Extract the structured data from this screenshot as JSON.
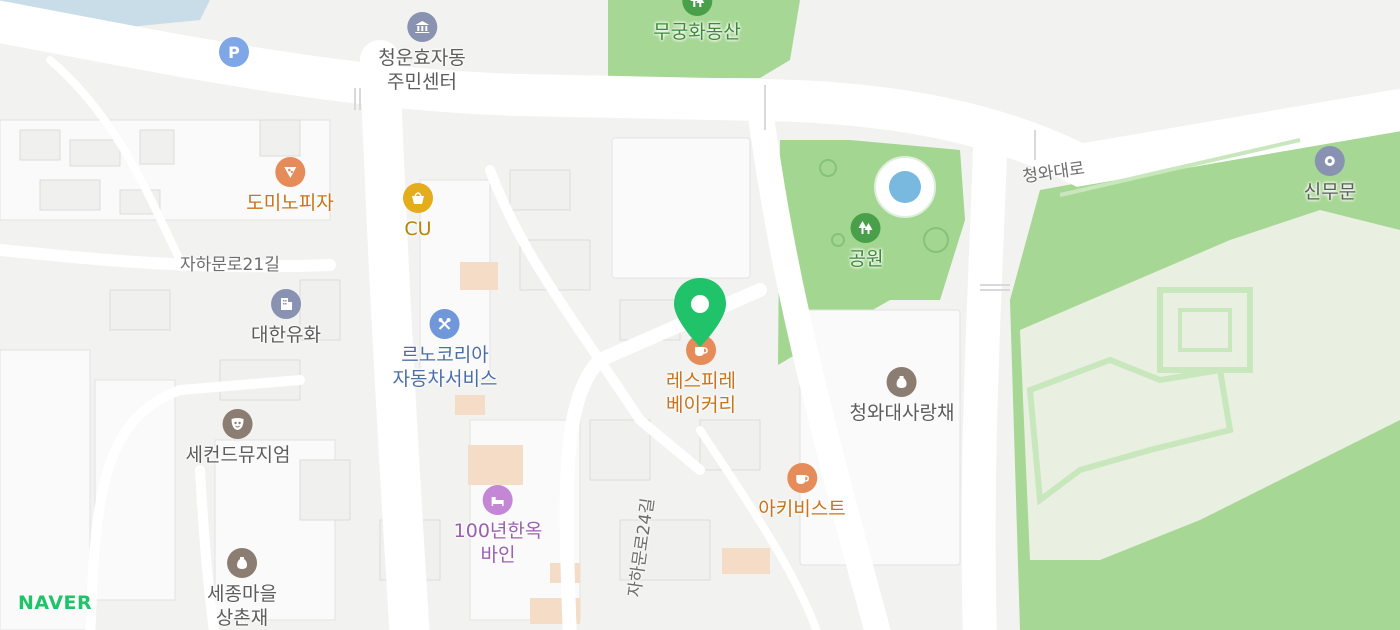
{
  "map": {
    "colors": {
      "land": "#f2f2f0",
      "block": "#fafafa",
      "road": "#ffffff",
      "park": "#9ed48a",
      "water": "#c9dde8",
      "pin": "#20c26a"
    },
    "logo": "NAVER",
    "pois": [
      {
        "label_lines": [
          "무궁화동산"
        ],
        "icon": "park-tree-icon",
        "color": "#3f8a3a",
        "iconColor": "#4aa04a"
      },
      {
        "label_lines": [
          "청운효자동",
          "주민센터"
        ],
        "icon": "government-building-icon",
        "color": "#5d5d5d",
        "iconColor": "#8a92b2"
      },
      {
        "label_lines": [],
        "icon": "parking-icon",
        "color": "#5d5d5d",
        "iconColor": "#7fa6e6",
        "text": "P"
      },
      {
        "label_lines": [
          "도미노피자"
        ],
        "icon": "pizza-icon",
        "color": "#c9731a",
        "iconColor": "#e58c5a"
      },
      {
        "label_lines": [
          "CU"
        ],
        "icon": "convenience-store-icon",
        "color": "#b88400",
        "iconColor": "#e3ad1b"
      },
      {
        "label_lines": [
          "대한유화"
        ],
        "icon": "office-building-icon",
        "color": "#5d5d5d",
        "iconColor": "#8a92b2"
      },
      {
        "label_lines": [
          "르노코리아",
          "자동차서비스"
        ],
        "icon": "wrench-icon",
        "color": "#4a6fa8",
        "iconColor": "#6f97d9"
      },
      {
        "label_lines": [
          "세컨드뮤지엄"
        ],
        "icon": "museum-mask-icon",
        "color": "#5d5d5d",
        "iconColor": "#8b7d72"
      },
      {
        "label_lines": [
          "100년한옥",
          "바인"
        ],
        "icon": "lodging-icon",
        "color": "#9b5fb0",
        "iconColor": "#c487d6"
      },
      {
        "label_lines": [
          "세종마을",
          "상촌재"
        ],
        "icon": "heritage-icon",
        "color": "#5d5d5d",
        "iconColor": "#8b7d72"
      },
      {
        "label_lines": [
          "레스피레",
          "베이커리"
        ],
        "icon": "cafe-cup-icon",
        "color": "#c9731a",
        "iconColor": "#e58c5a"
      },
      {
        "label_lines": [
          "아키비스트"
        ],
        "icon": "cafe-cup-icon",
        "color": "#c9731a",
        "iconColor": "#e58c5a"
      },
      {
        "label_lines": [
          "공원"
        ],
        "icon": "park-tree-icon",
        "color": "#3f8a3a",
        "iconColor": "#4aa04a"
      },
      {
        "label_lines": [
          "청와대사랑채"
        ],
        "icon": "heritage-icon",
        "color": "#5d5d5d",
        "iconColor": "#8b7d72"
      },
      {
        "label_lines": [
          "신무문"
        ],
        "icon": "gate-icon",
        "color": "#5d5d5d",
        "iconColor": "#8a92b2"
      }
    ],
    "roads": [
      "자하문로21길",
      "자하문로24길",
      "청와대로"
    ]
  }
}
